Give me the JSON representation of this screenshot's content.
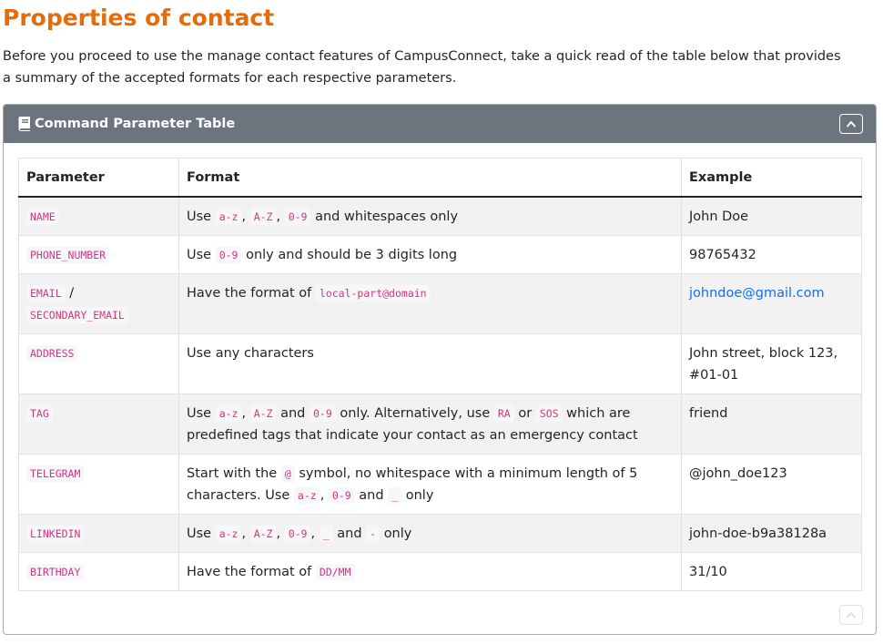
{
  "page_title": "Properties of contact",
  "intro_text": "Before you proceed to use the manage contact features of CampusConnect, take a quick read of the table below that provides a summary of the accepted formats for each respective parameters.",
  "card": {
    "title": "Command Parameter Table",
    "headers": [
      "Parameter",
      "Format",
      "Example"
    ]
  },
  "rows": {
    "name": {
      "param": "NAME",
      "f1": "Use",
      "c1": "a-z",
      "s1": ",",
      "c2": "A-Z",
      "s2": ",",
      "c3": "0-9",
      "f2": "and whitespaces only",
      "example": "John Doe"
    },
    "phone": {
      "param": "PHONE_NUMBER",
      "f1": "Use",
      "c1": "0-9",
      "f2": "only and should be 3 digits long",
      "example": "98765432"
    },
    "email": {
      "param": "EMAIL",
      "sep": "/",
      "param2": "SECONDARY_EMAIL",
      "f1": "Have the format of",
      "c1": "local-part@domain",
      "example": "johndoe@gmail.com"
    },
    "address": {
      "param": "ADDRESS",
      "f1": "Use any characters",
      "example": "John street, block 123, #01-01"
    },
    "tag": {
      "param": "TAG",
      "f1": "Use",
      "c1": "a-z",
      "s1": ",",
      "c2": "A-Z",
      "f2": "and",
      "c3": "0-9",
      "f3": "only. Alternatively, use",
      "c4": "RA",
      "f4": "or",
      "c5": "SOS",
      "f5": "which are predefined tags that indicate your contact as an emergency contact",
      "example": "friend"
    },
    "telegram": {
      "param": "TELEGRAM",
      "f1": "Start with the",
      "c1": "@",
      "f2": "symbol, no whitespace with a minimum length of 5 characters. Use",
      "c2": "a-z",
      "s1": ",",
      "c3": "0-9",
      "f3": "and",
      "c4": "_",
      "f4": "only",
      "example": "@john_doe123"
    },
    "linkedin": {
      "param": "LINKEDIN",
      "f1": "Use",
      "c1": "a-z",
      "s1": ",",
      "c2": "A-Z",
      "s2": ",",
      "c3": "0-9",
      "s3": ",",
      "c4": "_",
      "f2": "and",
      "c5": "-",
      "f3": "only",
      "example": "john-doe-b9a38128a"
    },
    "birthday": {
      "param": "BIRTHDAY",
      "f1": "Have the format of",
      "c1": "DD/MM",
      "example": "31/10"
    }
  },
  "icons": {
    "header": "book-icon",
    "collapse": "chevron-up-icon"
  },
  "colors": {
    "title": "#e46c0a",
    "card_header": "#6c757d",
    "code": "#d63384",
    "link": "#0d6efd",
    "row_stripe": "#f2f2f2"
  }
}
